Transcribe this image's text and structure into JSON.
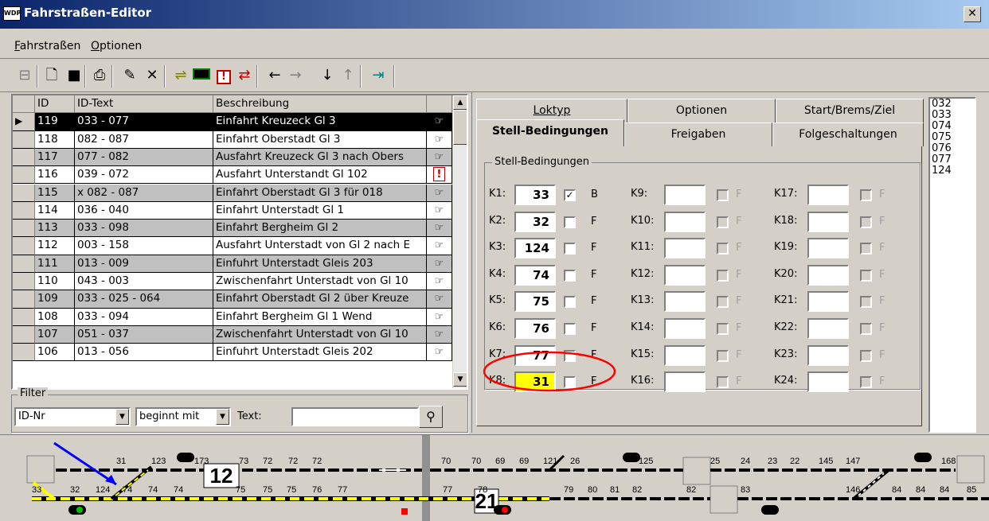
{
  "window": {
    "title": "Fahrstraßen-Editor",
    "app_icon_text": "WDP",
    "close_glyph": "✕"
  },
  "menu": [
    {
      "label": "Fahrstraßen",
      "underline": "F"
    },
    {
      "label": "Optionen",
      "underline": "O"
    }
  ],
  "toolbar": {
    "buttons": [
      "layout-icon",
      "new-doc-icon",
      "save-icon",
      "print-icon",
      "edit-icon",
      "delete-icon",
      "route-icon",
      "signal-icon",
      "warning-icon",
      "swap-icon",
      "arrow-left-icon",
      "arrow-right-icon",
      "arrow-down-icon",
      "arrow-up-icon",
      "exit-icon"
    ]
  },
  "grid": {
    "headers": [
      "ID",
      "ID-Text",
      "Beschreibung",
      ""
    ],
    "rows": [
      {
        "id": "119",
        "id_text": "033 - 077",
        "desc": "Einfahrt Kreuzeck Gl 3",
        "icon": "hand",
        "selected": true
      },
      {
        "id": "118",
        "id_text": "082 - 087",
        "desc": "Einfahrt Oberstadt Gl 3",
        "icon": "hand"
      },
      {
        "id": "117",
        "id_text": "077 - 082",
        "desc": "Ausfahrt Kreuzeck Gl 3 nach Obers",
        "icon": "hand"
      },
      {
        "id": "116",
        "id_text": "039 - 072",
        "desc": "Ausfahrt Unterstandt Gl 102",
        "icon": "warn"
      },
      {
        "id": "115",
        "id_text": "x 082 - 087",
        "desc": "Einfahrt Oberstadt Gl 3 für 018",
        "icon": "hand"
      },
      {
        "id": "114",
        "id_text": "036 - 040",
        "desc": "Einfahrt Unterstadt Gl 1",
        "icon": "hand"
      },
      {
        "id": "113",
        "id_text": "033 - 098",
        "desc": "Einfahrt Bergheim Gl 2",
        "icon": "hand"
      },
      {
        "id": "112",
        "id_text": "003 - 158",
        "desc": "Ausfahrt Unterstadt von Gl 2 nach E",
        "icon": "hand"
      },
      {
        "id": "111",
        "id_text": "013 - 009",
        "desc": "Einfuhrt Unterstadt Gleis 203",
        "icon": "hand"
      },
      {
        "id": "110",
        "id_text": "043 - 003",
        "desc": "Zwischenfahrt Unterstadt von Gl 10",
        "icon": "hand"
      },
      {
        "id": "109",
        "id_text": "033 - 025 - 064",
        "desc": "Einfahrt Oberstadt Gl 2 über Kreuze",
        "icon": "hand"
      },
      {
        "id": "108",
        "id_text": "033 - 094",
        "desc": "Einfahrt Bergheim Gl 1 Wend",
        "icon": "hand"
      },
      {
        "id": "107",
        "id_text": "051 - 037",
        "desc": "Zwischenfahrt Unterstadt von Gl 10",
        "icon": "hand"
      },
      {
        "id": "106",
        "id_text": "013 - 056",
        "desc": "Einfuhrt Unterstadt Gleis 202",
        "icon": "hand"
      }
    ]
  },
  "filter": {
    "label": "Filter",
    "field": "ID-Nr",
    "mode": "beginnt mit",
    "text_label": "Text:",
    "text_value": ""
  },
  "tabs": {
    "row1": [
      "Loktyp",
      "Optionen",
      "Start/Brems/Ziel"
    ],
    "row2": [
      "Stell-Bedingungen",
      "Freigaben",
      "Folgeschaltungen"
    ],
    "active": "Stell-Bedingungen"
  },
  "conditions": {
    "group_label": "Stell-Bedingungen",
    "items": [
      {
        "label": "K1:",
        "value": "33",
        "checked": true,
        "flag": "B"
      },
      {
        "label": "K2:",
        "value": "32",
        "checked": false,
        "flag": "F"
      },
      {
        "label": "K3:",
        "value": "124",
        "checked": false,
        "flag": "F"
      },
      {
        "label": "K4:",
        "value": "74",
        "checked": false,
        "flag": "F"
      },
      {
        "label": "K5:",
        "value": "75",
        "checked": false,
        "flag": "F"
      },
      {
        "label": "K6:",
        "value": "76",
        "checked": false,
        "flag": "F"
      },
      {
        "label": "K7:",
        "value": "77",
        "checked": false,
        "flag": "F"
      },
      {
        "label": "K8:",
        "value": "31",
        "checked": false,
        "flag": "F",
        "highlight": true
      },
      {
        "label": "K9:",
        "value": "",
        "flag": "F"
      },
      {
        "label": "K10:",
        "value": "",
        "flag": "F"
      },
      {
        "label": "K11:",
        "value": "",
        "flag": "F"
      },
      {
        "label": "K12:",
        "value": "",
        "flag": "F"
      },
      {
        "label": "K13:",
        "value": "",
        "flag": "F"
      },
      {
        "label": "K14:",
        "value": "",
        "flag": "F"
      },
      {
        "label": "K15:",
        "value": "",
        "flag": "F"
      },
      {
        "label": "K16:",
        "value": "",
        "flag": "F"
      },
      {
        "label": "K17:",
        "value": "",
        "flag": "F"
      },
      {
        "label": "K18:",
        "value": "",
        "flag": "F"
      },
      {
        "label": "K19:",
        "value": "",
        "flag": "F"
      },
      {
        "label": "K20:",
        "value": "",
        "flag": "F"
      },
      {
        "label": "K21:",
        "value": "",
        "flag": "F"
      },
      {
        "label": "K22:",
        "value": "",
        "flag": "F"
      },
      {
        "label": "K23:",
        "value": "",
        "flag": "F"
      },
      {
        "label": "K24:",
        "value": "",
        "flag": "F"
      }
    ]
  },
  "side_list": [
    "032",
    "033",
    "074",
    "075",
    "076",
    "077",
    "124"
  ],
  "track": {
    "block_numbers": [
      "12",
      "21"
    ],
    "top_labels": [
      "31",
      "123",
      "173",
      "73",
      "72",
      "72",
      "72",
      "70",
      "70",
      "69",
      "69",
      "121",
      "26",
      "125",
      "25",
      "24",
      "23",
      "22",
      "145",
      "147",
      "168"
    ],
    "bottom_labels": [
      "33",
      "32",
      "124",
      "74",
      "74",
      "74",
      "75",
      "75",
      "75",
      "76",
      "77",
      "77",
      "78",
      "79",
      "80",
      "81",
      "82",
      "82",
      "83",
      "146",
      "84",
      "84",
      "84",
      "85"
    ],
    "colors": {
      "route": "#ffff00",
      "track": "#000000",
      "annotation": "#ff0000",
      "arrow": "#0000ff"
    }
  }
}
